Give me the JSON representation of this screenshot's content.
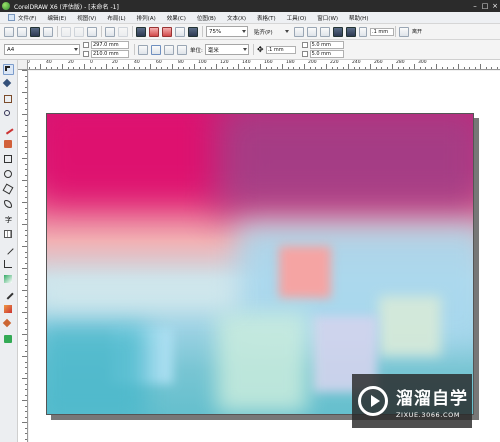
{
  "window": {
    "title": "CorelDRAW X6 (评估版) - [未命名 -1]",
    "controls": [
      "–",
      "□",
      "×"
    ]
  },
  "menu": [
    "文件(F)",
    "编辑(E)",
    "视图(V)",
    "布局(L)",
    "排列(A)",
    "效果(C)",
    "位图(B)",
    "文本(X)",
    "表格(T)",
    "工具(O)",
    "窗口(W)",
    "帮助(H)"
  ],
  "toolbar": {
    "zoom": "75%",
    "snap": "贴齐(P)"
  },
  "propertybar": {
    "paper_size": "A4",
    "width": "297.0 mm",
    "height": "210.0 mm",
    "units_label": "单位:",
    "units_value": "毫米",
    "nudge": ".1 mm",
    "dup_x": "5.0 mm",
    "dup_y": "5.0 mm",
    "right_nudge": ".1 mm",
    "right_label": "离开"
  },
  "ruler": {
    "labels": [
      "60",
      "40",
      "20",
      "0",
      "20",
      "40",
      "60",
      "80",
      "100",
      "120",
      "140",
      "160",
      "180",
      "200",
      "220",
      "240",
      "260",
      "280",
      "300"
    ]
  },
  "toolbox": {
    "text_tool_label": "字"
  },
  "watermark": {
    "title": "溜溜自学",
    "url": "ZIXUE.3066.COM"
  },
  "colors": {
    "titlebar": "#2b2b2b",
    "magenta": "#e0156f",
    "plum": "#a83a82",
    "pink": "#f2a6ac",
    "sky": "#a9d6ea",
    "teal": "#4fb8c9"
  }
}
